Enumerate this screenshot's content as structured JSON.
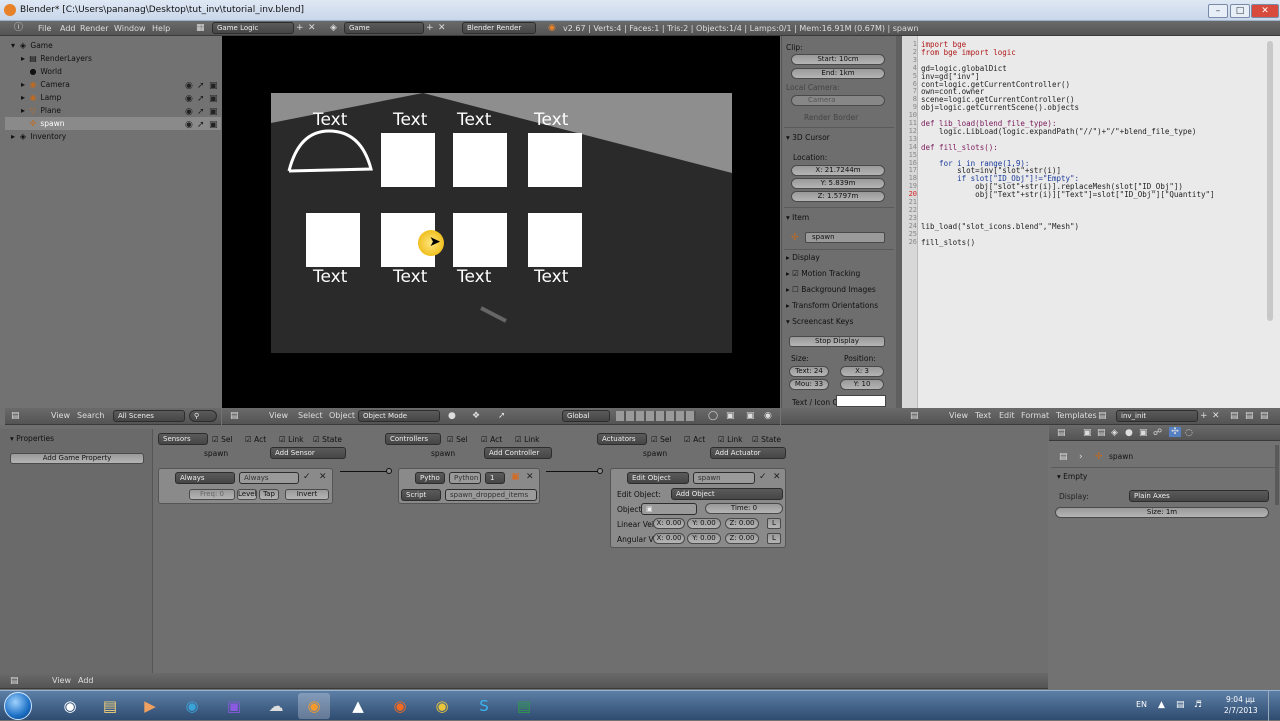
{
  "window": {
    "title": "Blender* [C:\\Users\\pananag\\Desktop\\tut_inv\\tutorial_inv.blend]"
  },
  "info_header": {
    "menus": [
      "File",
      "Add",
      "Render",
      "Window",
      "Help"
    ],
    "screen_layout": "Game Logic",
    "scene": "Game",
    "engine": "Blender Render",
    "stats": "v2.67 | Verts:4 | Faces:1 | Tris:2 | Objects:1/4 | Lamps:0/1 | Mem:16.91M (0.67M) | spawn"
  },
  "outliner": {
    "items": [
      {
        "label": "Game",
        "icon": "scene-icon"
      },
      {
        "label": "RenderLayers",
        "icon": "render-layers-icon"
      },
      {
        "label": "World",
        "icon": "world-icon"
      },
      {
        "label": "Camera",
        "icon": "camera-icon"
      },
      {
        "label": "Lamp",
        "icon": "lamp-icon"
      },
      {
        "label": "Plane",
        "icon": "mesh-icon"
      },
      {
        "label": "spawn",
        "icon": "empty-icon"
      },
      {
        "label": "Inventory",
        "icon": "scene-icon"
      }
    ],
    "header": {
      "view": "View",
      "search": "Search",
      "filter": "All Scenes"
    }
  },
  "viewport": {
    "slot_labels": [
      "Text",
      "Text",
      "Text",
      "Text",
      "Text",
      "Text",
      "Text",
      "Text"
    ],
    "header": {
      "view": "View",
      "select": "Select",
      "object": "Object",
      "mode": "Object Mode",
      "orientation": "Global"
    }
  },
  "properties_panel": {
    "clip_title": "Clip:",
    "clip_start": "Start: 10cm",
    "clip_end": "End: 1km",
    "local_camera": "Local Camera:",
    "camera_field": "Camera",
    "render_border": "Render Border",
    "cursor_title": "3D Cursor",
    "location_label": "Location:",
    "cursor_x": "X: 21.7244m",
    "cursor_y": "Y: 5.839m",
    "cursor_z": "Z: 1.5797m",
    "item_title": "Item",
    "item_name": "spawn",
    "display": "Display",
    "motion_tracking": "Motion Tracking",
    "background_images": "Background Images",
    "transform_orientations": "Transform Orientations",
    "screencast_keys": "Screencast Keys",
    "stop_display": "Stop Display",
    "size_label": "Size:",
    "position_label": "Position:",
    "text_size": "Text: 24",
    "mouse_size": "Mou: 33",
    "pos_x": "X: 3",
    "pos_y": "Y: 10",
    "text_icon_label": "Text / Icon C"
  },
  "text_editor": {
    "lines": [
      "import bge",
      "from bge import logic",
      "",
      "gd=logic.globalDict",
      "inv=gd[\"inv\"]",
      "cont=logic.getCurrentController()",
      "own=cont.owner",
      "scene=logic.getCurrentController()",
      "obj=logic.getCurrentScene().objects",
      "",
      "def lib_load(blend_file_type):",
      "    logic.LibLoad(logic.expandPath(\"//\")+\"/\"+blend_file_type)",
      "",
      "def fill_slots():",
      "",
      "    for i in range(1,9):",
      "        slot=inv[\"slot\"+str(i)]",
      "        if slot[\"ID_Obj\"]!=\"Empty\":",
      "            obj[\"slot\"+str(i)].replaceMesh(slot[\"ID_Obj\"])",
      "            obj[\"Text\"+str(i)][\"Text\"]=slot[\"ID_Obj\"][\"Quantity\"]",
      "",
      "",
      "",
      "lib_load(\"slot_icons.blend\",\"Mesh\")",
      "",
      "fill_slots()"
    ],
    "line_numbers": [
      "1",
      "2",
      "3",
      "4",
      "5",
      "6",
      "7",
      "8",
      "9",
      "10",
      "11",
      "12",
      "13",
      "14",
      "15",
      "16",
      "17",
      "18",
      "19",
      "20",
      "21",
      "22",
      "23",
      "24",
      "25",
      "26"
    ],
    "header": {
      "view": "View",
      "text": "Text",
      "edit": "Edit",
      "format": "Format",
      "templates": "Templates",
      "file": "inv_init"
    }
  },
  "logic_editor": {
    "header": {
      "title": "Properties",
      "add_game_property": "Add Game Property"
    },
    "sensors": {
      "label": "Sensors",
      "sel": "Sel",
      "act": "Act",
      "link": "Link",
      "state": "State",
      "object": "spawn",
      "add": "Add Sensor",
      "brick_type": "Always",
      "brick_name": "Always",
      "freq": "Freq: 0",
      "level": "Level",
      "tap": "Tap",
      "invert": "Invert"
    },
    "controllers": {
      "label": "Controllers",
      "sel": "Sel",
      "act": "Act",
      "link": "Link",
      "object": "spawn",
      "add": "Add Controller",
      "brick_type": "Pytho",
      "brick_name": "Python",
      "priority": "1",
      "script_mode": "Script",
      "script": "spawn_dropped_items"
    },
    "actuators": {
      "label": "Actuators",
      "sel": "Sel",
      "act": "Act",
      "link": "Link",
      "state": "State",
      "object": "spawn",
      "add": "Add Actuator",
      "brick_type": "Edit Object",
      "brick_name": "spawn",
      "edit_object_label": "Edit Object:",
      "edit_object_value": "Add Object",
      "object_label": "Object:",
      "time": "Time: 0",
      "linear_vel": "Linear Vel",
      "angular_vel": "Angular Ve",
      "vx": "X: 0.00",
      "vy": "Y: 0.00",
      "vz": "Z: 0.00",
      "l": "L"
    },
    "bottom": {
      "view": "View",
      "add": "Add"
    }
  },
  "object_props": {
    "object_name": "spawn",
    "empty_title": "Empty",
    "display_label": "Display:",
    "display_value": "Plain Axes",
    "size": "Size: 1m"
  },
  "taskbar": {
    "lang": "EN",
    "time": "9:04 μμ",
    "date": "2/7/2013"
  }
}
